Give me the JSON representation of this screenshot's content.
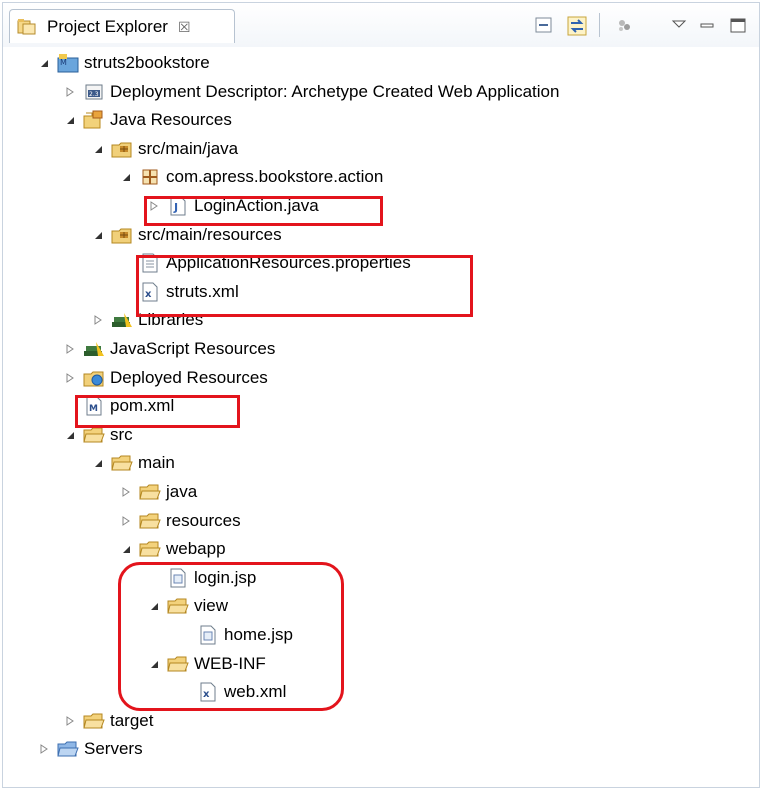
{
  "panel": {
    "title": "Project Explorer",
    "close_glyph": "☒"
  },
  "toolbar": {
    "icons": [
      "collapse-all-icon",
      "link-with-editor-icon",
      "filter-icon",
      "view-menu-icon",
      "minimize-icon",
      "maximize-icon"
    ]
  },
  "tree": [
    {
      "label": "struts2bookstore",
      "icon": "web-project-icon",
      "state": "expanded"
    },
    {
      "label": "Deployment Descriptor: Archetype Created Web Application",
      "icon": "deployment-descriptor-icon",
      "state": "collapsed"
    },
    {
      "label": "Java Resources",
      "icon": "java-resources-icon",
      "state": "expanded"
    },
    {
      "label": "src/main/java",
      "icon": "source-folder-icon",
      "state": "expanded"
    },
    {
      "label": "com.apress.bookstore.action",
      "icon": "package-icon",
      "state": "expanded"
    },
    {
      "label": "LoginAction.java",
      "icon": "java-file-icon",
      "state": "collapsed"
    },
    {
      "label": "src/main/resources",
      "icon": "source-folder-icon",
      "state": "expanded"
    },
    {
      "label": "ApplicationResources.properties",
      "icon": "properties-file-icon",
      "state": "leaf"
    },
    {
      "label": "struts.xml",
      "icon": "xml-file-icon",
      "state": "leaf"
    },
    {
      "label": "Libraries",
      "icon": "libraries-icon",
      "state": "collapsed"
    },
    {
      "label": "JavaScript Resources",
      "icon": "libraries-icon",
      "state": "collapsed"
    },
    {
      "label": "Deployed Resources",
      "icon": "deployed-resources-icon",
      "state": "collapsed"
    },
    {
      "label": "pom.xml",
      "icon": "maven-pom-icon",
      "state": "leaf"
    },
    {
      "label": "src",
      "icon": "folder-icon",
      "state": "expanded"
    },
    {
      "label": "main",
      "icon": "folder-icon",
      "state": "expanded"
    },
    {
      "label": "java",
      "icon": "folder-icon",
      "state": "collapsed"
    },
    {
      "label": "resources",
      "icon": "folder-icon",
      "state": "collapsed"
    },
    {
      "label": "webapp",
      "icon": "folder-icon",
      "state": "expanded"
    },
    {
      "label": "login.jsp",
      "icon": "jsp-file-icon",
      "state": "leaf"
    },
    {
      "label": "view",
      "icon": "folder-icon",
      "state": "expanded"
    },
    {
      "label": "home.jsp",
      "icon": "jsp-file-icon",
      "state": "leaf"
    },
    {
      "label": "WEB-INF",
      "icon": "folder-icon",
      "state": "expanded"
    },
    {
      "label": "web.xml",
      "icon": "xml-file-icon",
      "state": "leaf"
    },
    {
      "label": "target",
      "icon": "folder-icon",
      "state": "collapsed"
    },
    {
      "label": "Servers",
      "icon": "servers-folder-icon",
      "state": "collapsed"
    }
  ],
  "highlight_color": "#e3141c"
}
